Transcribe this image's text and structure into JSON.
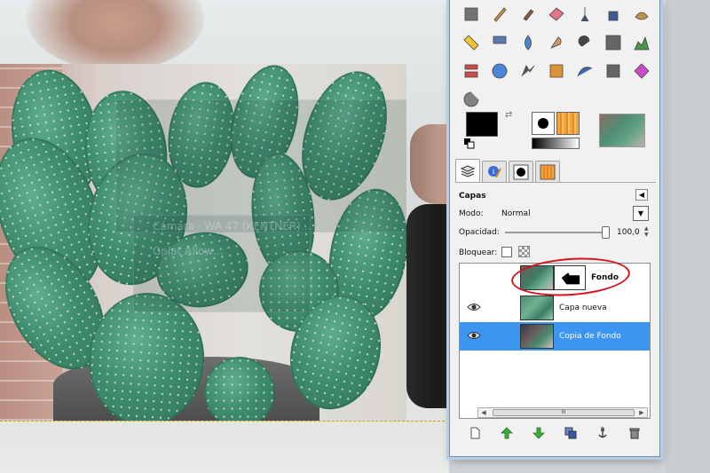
{
  "canvas": {
    "ghost_text": "Cámara · WA 47 (KENTNER)…",
    "ghost_text2": "Gplat Allow…"
  },
  "toolbox": {
    "tools": [
      {
        "name": "rect-select-icon",
        "color": "#666"
      },
      {
        "name": "pencil-icon",
        "color": "#d08a2a"
      },
      {
        "name": "paintbrush-icon",
        "color": "#7a4a2a"
      },
      {
        "name": "eraser-icon",
        "color": "#e06a7a"
      },
      {
        "name": "airbrush-icon",
        "color": "#345"
      },
      {
        "name": "ink-icon",
        "color": "#2a4a8a"
      },
      {
        "name": "clone-icon",
        "color": "#b88a3a"
      },
      {
        "name": "heal-icon",
        "color": "#f0c020"
      },
      {
        "name": "perspective-clone-icon",
        "color": "#4a6aa8"
      },
      {
        "name": "blur-icon",
        "color": "#3a7ac8"
      },
      {
        "name": "smudge-icon",
        "color": "#c89060"
      },
      {
        "name": "dodge-burn-icon",
        "color": "#333"
      },
      {
        "name": "gradient-icon",
        "color": "#555"
      },
      {
        "name": "levels-icon",
        "color": "#3a8a3a"
      },
      {
        "name": "color-balance-icon",
        "color": "#c83a3a"
      },
      {
        "name": "hue-saturation-icon",
        "color": "#3a7ad8"
      },
      {
        "name": "threshold-icon",
        "color": "#444"
      },
      {
        "name": "colorize-icon",
        "color": "#d88a20"
      },
      {
        "name": "curves-icon",
        "color": "#2a5aa8"
      },
      {
        "name": "posterize-icon",
        "color": "#555"
      },
      {
        "name": "color-rotate-icon",
        "color": "#c83ac8"
      },
      {
        "name": "gegl-icon",
        "color": "#777"
      }
    ]
  },
  "layers_panel": {
    "title": "Capas",
    "mode_label": "Modo:",
    "mode_value": "Normal",
    "opacity_label": "Opacidad:",
    "opacity_value": "100,0",
    "opacity_fraction": 1.0,
    "lock_label": "Bloquear:",
    "layers": [
      {
        "name": "Fondo",
        "visible": false,
        "selected": false,
        "has_mask": true,
        "bold": true
      },
      {
        "name": "Capa nueva",
        "visible": true,
        "selected": false,
        "has_mask": false,
        "bold": false
      },
      {
        "name": "Copia de Fondo",
        "visible": true,
        "selected": true,
        "has_mask": false,
        "bold": false
      }
    ],
    "scroll_thumb_label": "III"
  },
  "colors": {
    "selection": "#3d95f2",
    "annotation": "#d8111a",
    "foreground": "#000000",
    "background": "#ffffff"
  }
}
